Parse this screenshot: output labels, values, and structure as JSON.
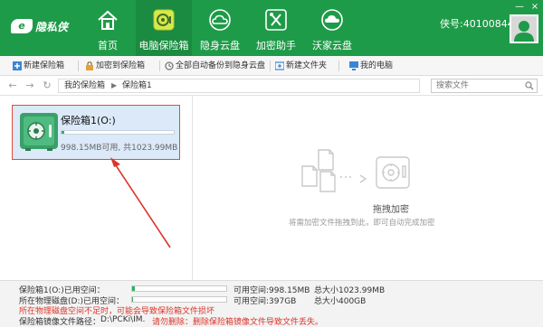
{
  "app": {
    "logo_text": "隐私侠",
    "brand_color": "#1e9b48"
  },
  "nav": [
    {
      "label": "首页",
      "icon": "home-icon"
    },
    {
      "label": "电脑保险箱",
      "icon": "safe-icon"
    },
    {
      "label": "隐身云盘",
      "icon": "cloud-icon"
    },
    {
      "label": "加密助手",
      "icon": "tools-icon"
    },
    {
      "label": "沃家云盘",
      "icon": "wo-cloud-icon"
    }
  ],
  "account": {
    "label": "侠号:40100844"
  },
  "window_controls": {
    "minimize": "—",
    "close": "×"
  },
  "toolbar": {
    "new_safe": "新建保险箱",
    "encrypt_to_safe": "加密到保险箱",
    "backup_all": "全部自动备份到隐身云盘",
    "new_folder": "新建文件夹",
    "my_computer": "我的电脑"
  },
  "address": {
    "crumbs": [
      "我的保险箱",
      "保险箱1"
    ],
    "search_placeholder": "搜索文件"
  },
  "safe": {
    "name": "保险箱1(O:)",
    "info": "998.15MB可用, 共1023.99MB",
    "used_fraction": 0.025
  },
  "drop": {
    "title": "拖拽加密",
    "desc": "将需加密文件拖拽到此，即可自动完成加密"
  },
  "status": {
    "safe_used_label": "保险箱1(O:)已用空间：",
    "safe_free": "可用空间:998.15MB",
    "safe_total": "总大小1023.99MB",
    "safe_used_fraction": 0.025,
    "disk_used_label": "所在物理磁盘(D:)已用空间：",
    "disk_free": "可用空间:397GB",
    "disk_total": "总大小400GB",
    "disk_used_fraction": 0.008,
    "warning": "所在物理磁盘空间不足时，可能会导致保险箱文件损坏",
    "path_label": "保险箱镜像文件路径：",
    "path": "D:\\PCKi\\IM.",
    "delete_warning": "请勿删除：删除保险箱镜像文件导致文件丢失。"
  }
}
